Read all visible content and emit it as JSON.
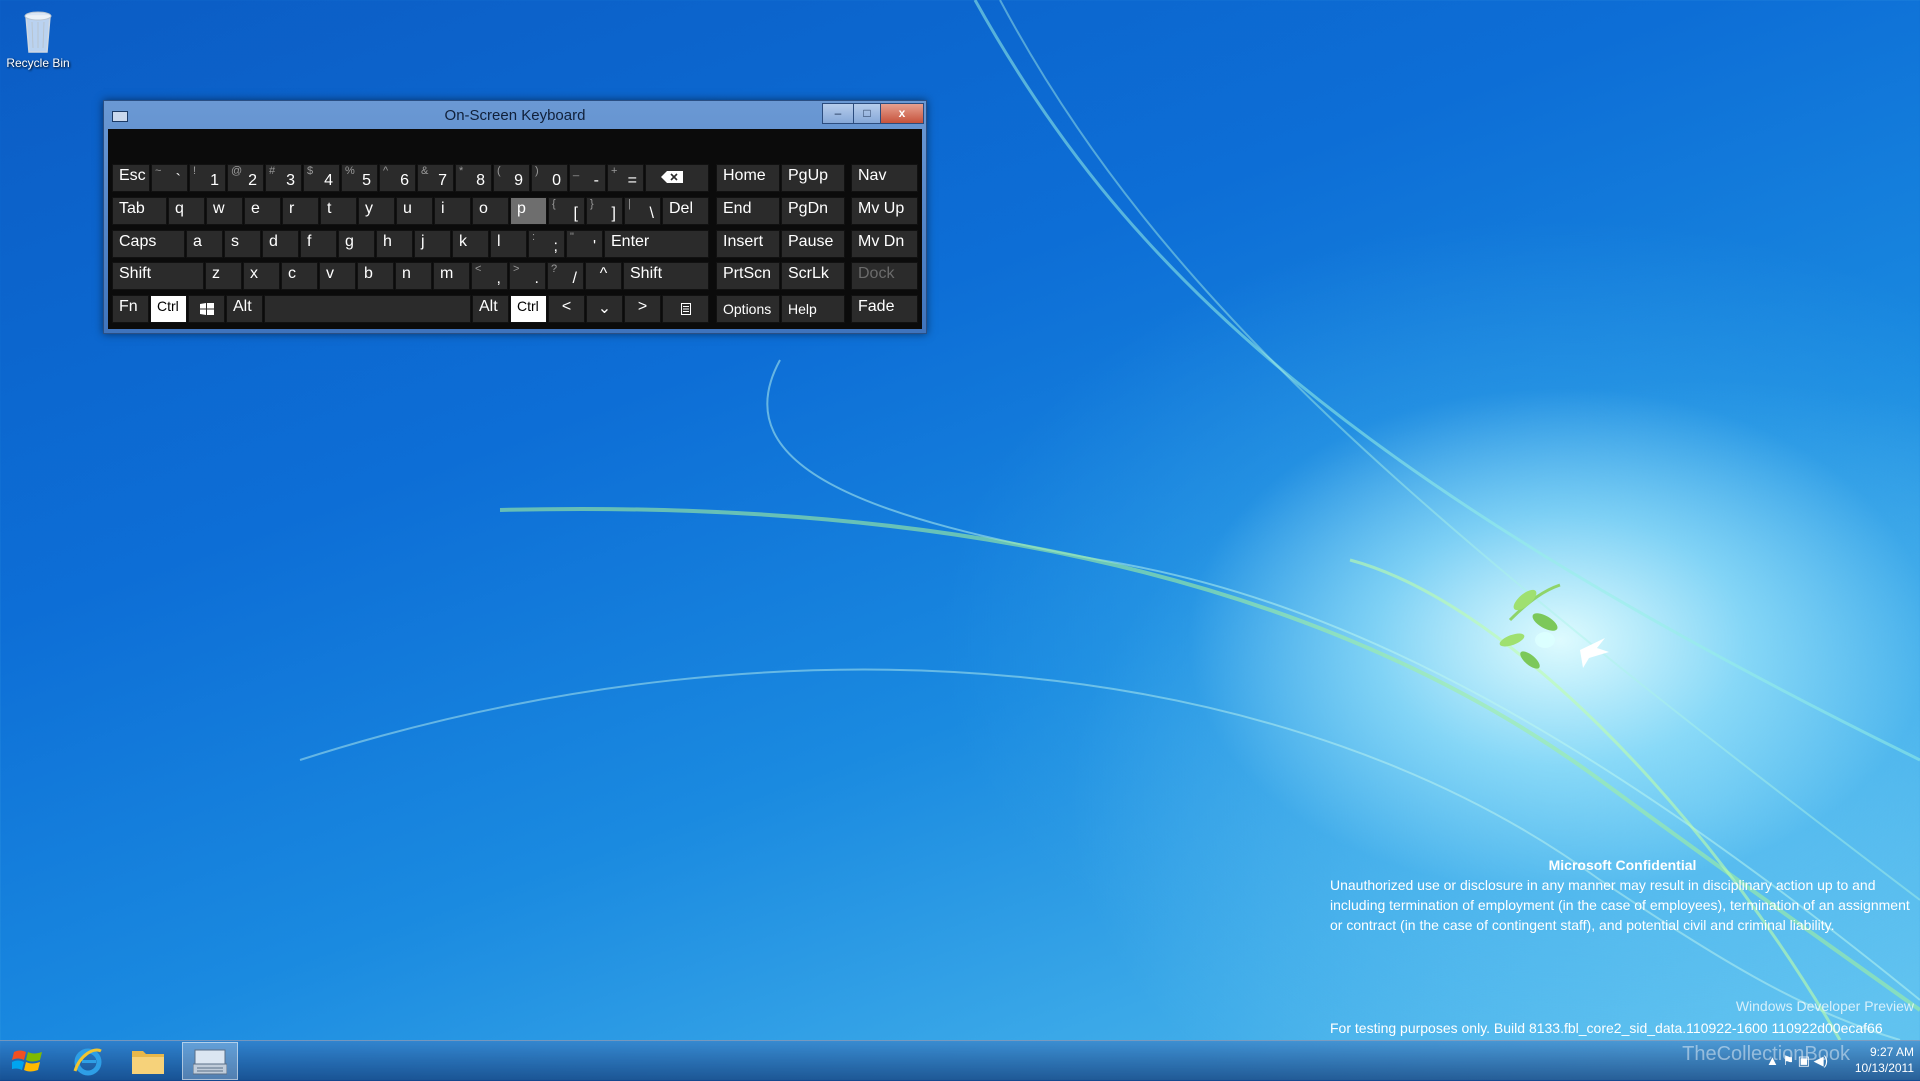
{
  "desktop": {
    "recycle_bin_label": "Recycle Bin"
  },
  "osk": {
    "title": "On-Screen Keyboard",
    "window_buttons": {
      "minimize": "–",
      "maximize": "□",
      "close": "x"
    },
    "keys": {
      "esc": "Esc",
      "tab": "Tab",
      "caps": "Caps",
      "shift_left": "Shift",
      "fn": "Fn",
      "ctrl_left": "Ctrl",
      "alt_left": "Alt",
      "alt_right": "Alt",
      "ctrl_right": "Ctrl",
      "del": "Del",
      "enter": "Enter",
      "shift_right": "Shift",
      "backtick_sub": "~",
      "backtick": "`",
      "n1_sub": "!",
      "n1": "1",
      "n2_sub": "@",
      "n2": "2",
      "n3_sub": "#",
      "n3": "3",
      "n4_sub": "$",
      "n4": "4",
      "n5_sub": "%",
      "n5": "5",
      "n6_sub": "^",
      "n6": "6",
      "n7_sub": "&",
      "n7": "7",
      "n8_sub": "*",
      "n8": "8",
      "n9_sub": "(",
      "n9": "9",
      "n0_sub": ")",
      "n0": "0",
      "minus_sub": "_",
      "minus": "-",
      "eq_sub": "+",
      "eq": "=",
      "q": "q",
      "w": "w",
      "e": "e",
      "r": "r",
      "t": "t",
      "y": "y",
      "u": "u",
      "i": "i",
      "o": "o",
      "p": "p",
      "lbr_sub": "{",
      "lbr": "[",
      "rbr_sub": "}",
      "rbr": "]",
      "bsl_sub": "|",
      "bsl": "\\",
      "a": "a",
      "s": "s",
      "d": "d",
      "f": "f",
      "g": "g",
      "h": "h",
      "j": "j",
      "k": "k",
      "l": "l",
      "semi_sub": ":",
      "semi": ";",
      "quote_sub": "\"",
      "quote": "'",
      "z": "z",
      "x": "x",
      "c": "c",
      "v": "v",
      "b": "b",
      "n": "n",
      "m": "m",
      "comma_sub": "<",
      "comma": ",",
      "period_sub": ">",
      "period": ".",
      "slash_sub": "?",
      "slash": "/",
      "up": "^",
      "left": "<",
      "down": "⌄",
      "right": ">",
      "home": "Home",
      "pgup": "PgUp",
      "nav": "Nav",
      "end": "End",
      "pgdn": "PgDn",
      "mvup": "Mv Up",
      "insert": "Insert",
      "pause": "Pause",
      "mvdn": "Mv Dn",
      "prtscn": "PrtScn",
      "scrlk": "ScrLk",
      "dock": "Dock",
      "options": "Options",
      "help": "Help",
      "fade": "Fade"
    }
  },
  "confidential": {
    "heading": "Microsoft Confidential",
    "text": "Unauthorized use or disclosure in any manner may result in disciplinary action up to and including termination of employment (in the case of employees), termination of an assignment or contract (in the case of contingent staff), and potential civil and criminal liability.",
    "edition": "Windows Developer Preview",
    "build": "For testing purposes only. Build 8133.fbl_core2_sid_data.110922-1600 110922d00ecaf66"
  },
  "taskbar": {
    "items": [
      "start-button",
      "internet-explorer",
      "file-explorer",
      "on-screen-keyboard"
    ],
    "watermark": "TheCollectionBook",
    "time": "9:27 AM",
    "date": "10/13/2011"
  },
  "colors": {
    "key_bg": "#2b2b2b",
    "key_highlight": "#6e6e6e",
    "key_active": "#ffffff",
    "osk_body": "#0b0b0b",
    "titlebar": "#5a8ad0"
  }
}
